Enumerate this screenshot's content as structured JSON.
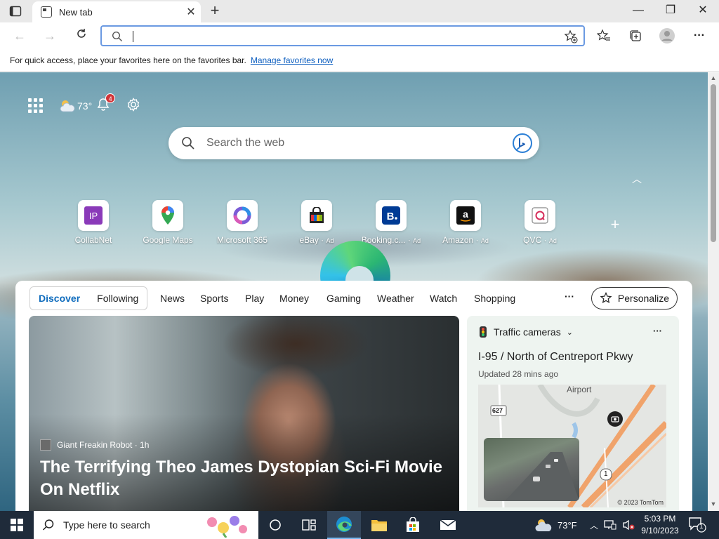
{
  "tab": {
    "title": "New tab"
  },
  "address": {
    "value": ""
  },
  "favorites_bar": {
    "message": "For quick access, place your favorites here on the favorites bar.",
    "link": "Manage favorites now"
  },
  "weather_mini": {
    "temp": "73°"
  },
  "notifications": {
    "count": "4"
  },
  "web_search": {
    "placeholder": "Search the web"
  },
  "quick_links": [
    {
      "label": "CollabNet",
      "ad": ""
    },
    {
      "label": "Google Maps",
      "ad": ""
    },
    {
      "label": "Microsoft 365",
      "ad": ""
    },
    {
      "label": "eBay",
      "ad": "Ad"
    },
    {
      "label": "Booking.c...",
      "ad": "Ad"
    },
    {
      "label": "Amazon",
      "ad": "Ad"
    },
    {
      "label": "QVC",
      "ad": "Ad"
    }
  ],
  "feed_nav": {
    "discover": "Discover",
    "following": "Following",
    "tabs": [
      "News",
      "Sports",
      "Play",
      "Money",
      "Gaming",
      "Weather",
      "Watch",
      "Shopping"
    ],
    "more": "···",
    "personalize": "Personalize"
  },
  "hero": {
    "source": "Giant Freakin Robot · 1h",
    "headline": "The Terrifying Theo James Dystopian Sci-Fi Movie On Netflix"
  },
  "traffic": {
    "header": "Traffic cameras",
    "road": "I-95 / North of Centreport Pkwy",
    "updated": "Updated 28 mins ago",
    "map_label": "Airport",
    "route_627": "627",
    "route_1": "1",
    "copyright": "© 2023 TomTom"
  },
  "taskbar": {
    "search_placeholder": "Type here to search",
    "temp": "73°F",
    "time": "5:03 PM",
    "date": "9/10/2023",
    "notif_count": "1"
  },
  "colors": {
    "accent": "#0f6cbd",
    "taskbar": "#1f2b3a",
    "address_border": "#6b9ae2"
  }
}
